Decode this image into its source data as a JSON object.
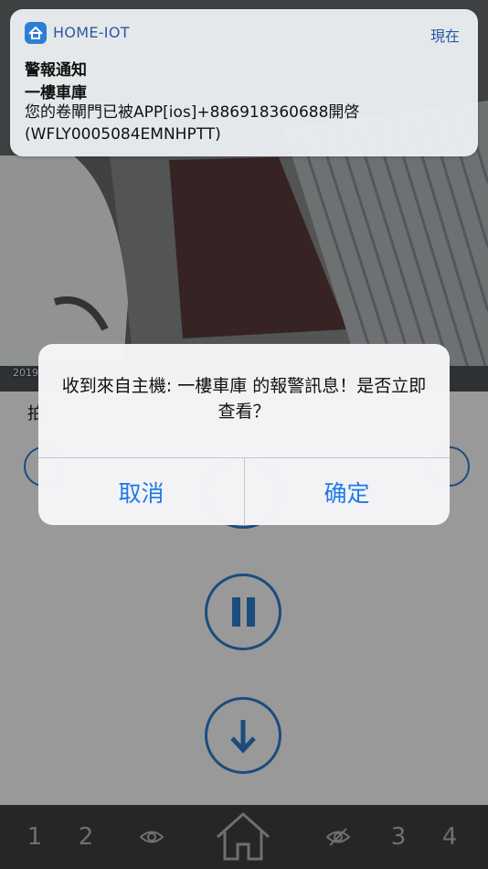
{
  "camera": {
    "timestamp": "2019",
    "label": "拍"
  },
  "controls": {
    "record_icon": "circle-icon",
    "pause_icon": "pause-icon",
    "download_icon": "download-arrow-icon"
  },
  "tabbar": {
    "tab1": "1",
    "tab2": "2",
    "tab3": "3",
    "tab4": "4",
    "eye_icon": "eye-icon",
    "home_icon": "home-icon",
    "eye_off_icon": "eye-off-icon"
  },
  "notification": {
    "app_name": "HOME-IOT",
    "time": "現在",
    "title": "警報通知",
    "subtitle": "一樓車庫",
    "body": "您的卷閘門已被APP[ios]+886918360688開啓(WFLY0005084EMNHPTT)"
  },
  "alert": {
    "message": "收到來自主機: 一樓車庫 的報警訊息！是否立即查看？",
    "cancel_label": "取消",
    "confirm_label": "确定"
  },
  "colors": {
    "accent": "#2f7fd1",
    "alert_button": "#1f7ae8",
    "tabbar_bg": "#404040"
  }
}
